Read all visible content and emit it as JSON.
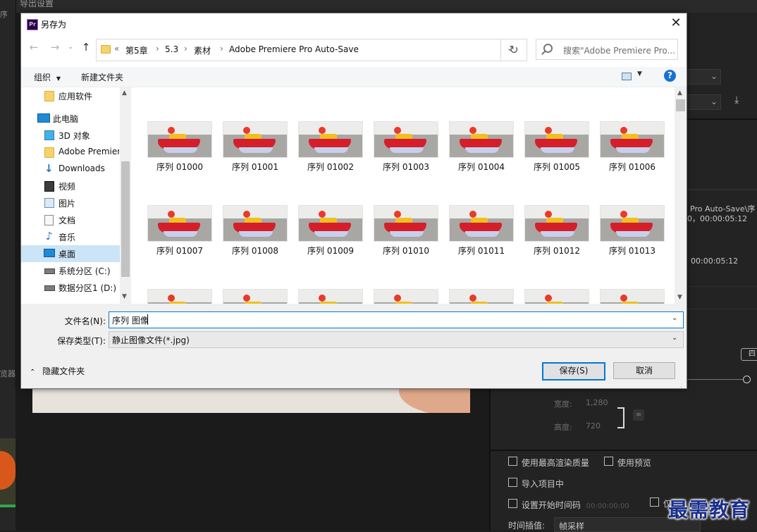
{
  "background": {
    "window_title": "导出设置",
    "left_label_top": "序",
    "left_label_bottom": "览器",
    "right_panel": {
      "path_text": "Pro Auto-Save\\序",
      "time_line": "0，00:00:05:12",
      "time_2": "00:00:05:12",
      "button_partial": "四",
      "width_label": "宽度:",
      "width_value": "1,280",
      "height_label": "高度:",
      "height_value": "720",
      "checkboxes": [
        {
          "label": "使用最高渲染质量"
        },
        {
          "label": "使用预览"
        },
        {
          "label": "导入项目中"
        },
        {
          "label": "设置开始时间码",
          "value": "00:00:00:00"
        },
        {
          "label": "仅"
        }
      ],
      "interp_label": "时间插值:",
      "interp_value": "帧采样"
    }
  },
  "watermark": "最需教育",
  "dialog": {
    "title": "另存为",
    "app_icon": "Pr",
    "breadcrumb": {
      "overflow": "«",
      "items": [
        "第5章",
        "5.3",
        "素材",
        "Adobe Premiere Pro Auto-Save"
      ]
    },
    "search_placeholder": "搜索\"Adobe Premiere Pro...",
    "toolbar": {
      "organize": "组织",
      "new_folder": "新建文件夹"
    },
    "sidebar": [
      {
        "label": "应用软件",
        "icon": "folder-icon"
      },
      {
        "label": "此电脑",
        "icon": "computer-icon"
      },
      {
        "label": "3D 对象",
        "icon": "3d-objects-icon"
      },
      {
        "label": "Adobe Premier",
        "icon": "folder-icon"
      },
      {
        "label": "Downloads",
        "icon": "download-icon"
      },
      {
        "label": "视频",
        "icon": "video-icon"
      },
      {
        "label": "图片",
        "icon": "pictures-icon"
      },
      {
        "label": "文档",
        "icon": "documents-icon"
      },
      {
        "label": "音乐",
        "icon": "music-icon"
      },
      {
        "label": "桌面",
        "icon": "desktop-icon",
        "selected": true
      },
      {
        "label": "系统分区 (C:)",
        "icon": "drive-icon"
      },
      {
        "label": "数据分区1 (D:)",
        "icon": "drive-icon"
      }
    ],
    "files": [
      "序列 01000",
      "序列 01001",
      "序列 01002",
      "序列 01003",
      "序列 01004",
      "序列 01005",
      "序列 01006",
      "序列 01007",
      "序列 01008",
      "序列 01009",
      "序列 01010",
      "序列 01011",
      "序列 01012",
      "序列 01013"
    ],
    "filename_label": "文件名(N):",
    "filename_value": "序列 图像",
    "filetype_label": "保存类型(T):",
    "filetype_value": "静止图像文件(*.jpg)",
    "hide_folders": "隐藏文件夹",
    "save_button": "保存(S)",
    "cancel_button": "取消"
  }
}
